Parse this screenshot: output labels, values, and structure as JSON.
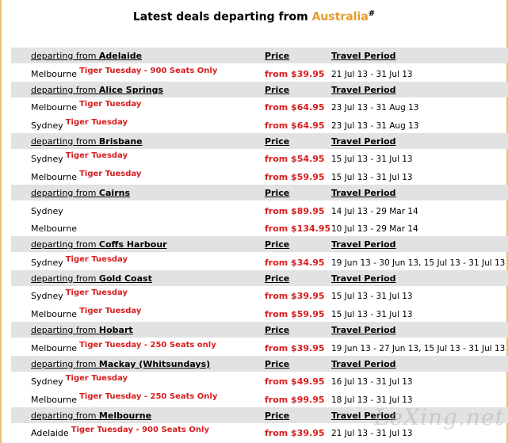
{
  "heading": {
    "prefix": "Latest deals departing from ",
    "country": "Australia",
    "mark": "#"
  },
  "labels": {
    "departing_from": "departing from ",
    "price": "Price",
    "travel_period": "Travel Period"
  },
  "sections": [
    {
      "origin": "Adelaide",
      "deals": [
        {
          "city": "Melbourne",
          "tag": "Tiger Tuesday - 900 Seats Only",
          "price": "from $39.95",
          "period": "21 Jul 13 - 31 Jul 13"
        }
      ]
    },
    {
      "origin": "Alice Springs",
      "deals": [
        {
          "city": "Melbourne",
          "tag": "Tiger Tuesday",
          "price": "from $64.95",
          "period": "23 Jul 13 - 31 Aug 13"
        },
        {
          "city": "Sydney",
          "tag": "Tiger Tuesday",
          "price": "from $64.95",
          "period": "23 Jul 13 - 31 Aug 13"
        }
      ]
    },
    {
      "origin": "Brisbane",
      "deals": [
        {
          "city": "Sydney",
          "tag": "Tiger Tuesday",
          "price": "from $54.95",
          "period": "15 Jul 13 - 31 Jul 13"
        },
        {
          "city": "Melbourne",
          "tag": "Tiger Tuesday",
          "price": "from $59.95",
          "period": "15 Jul 13 - 31 Jul 13"
        }
      ]
    },
    {
      "origin": "Cairns",
      "deals": [
        {
          "city": "Sydney",
          "tag": "",
          "price": "from $89.95",
          "period": "14 Jul 13 - 29 Mar 14"
        },
        {
          "city": "Melbourne",
          "tag": "",
          "price": "from $134.95",
          "period": "10 Jul 13 - 29 Mar 14"
        }
      ]
    },
    {
      "origin": "Coffs Harbour",
      "deals": [
        {
          "city": "Sydney",
          "tag": "Tiger Tuesday",
          "price": "from $34.95",
          "period": "19 Jun 13 - 30 Jun 13, 15 Jul 13 - 31 Jul 13"
        }
      ]
    },
    {
      "origin": "Gold Coast",
      "deals": [
        {
          "city": "Sydney",
          "tag": "Tiger Tuesday",
          "price": "from $39.95",
          "period": "15 Jul 13 - 31 Jul 13"
        },
        {
          "city": "Melbourne",
          "tag": "Tiger Tuesday",
          "price": "from $59.95",
          "period": "15 Jul 13 - 31 Jul 13"
        }
      ]
    },
    {
      "origin": "Hobart",
      "deals": [
        {
          "city": "Melbourne",
          "tag": "Tiger Tuesday - 250 Seats only",
          "price": "from $39.95",
          "period": "19 Jun 13 - 27 Jun 13, 15 Jul 13 - 31 Jul 13"
        }
      ]
    },
    {
      "origin": "Mackay (Whitsundays)",
      "deals": [
        {
          "city": "Sydney",
          "tag": "Tiger Tuesday",
          "price": "from $49.95",
          "period": "16 Jul 13 - 31 Jul 13"
        },
        {
          "city": "Melbourne",
          "tag": "Tiger Tuesday - 250 Seats Only",
          "price": "from $99.95",
          "period": "18 Jul 13 - 31 Jul 13"
        }
      ]
    },
    {
      "origin": "Melbourne",
      "deals": [
        {
          "city": "Adelaide",
          "tag": "Tiger Tuesday - 900 Seats Only",
          "price": "from $39.95",
          "period": "21 Jul 13 - 31 Jul 13"
        }
      ]
    }
  ],
  "watermark": "LeXing.net"
}
